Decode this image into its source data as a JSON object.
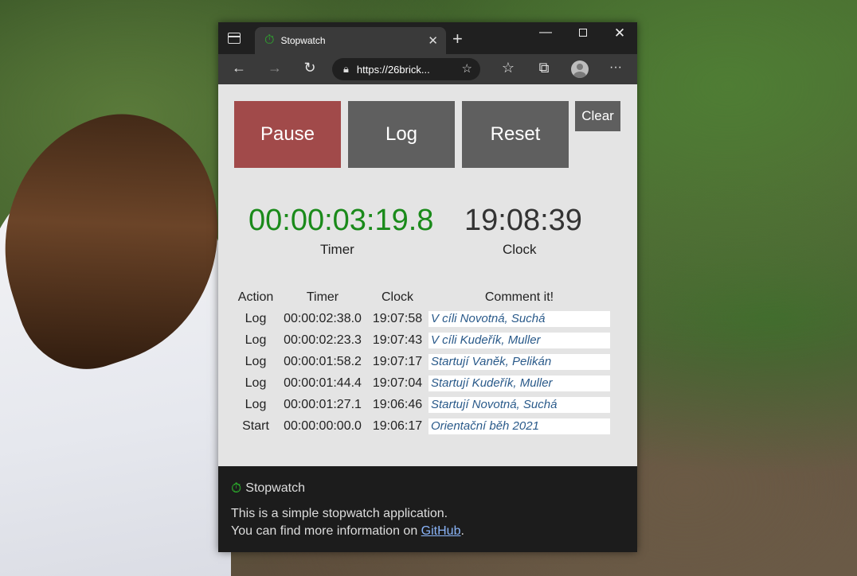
{
  "browser": {
    "tab_title": "Stopwatch",
    "url": "https://26brick...",
    "icons": {
      "tab_actions": "tab-actions-icon",
      "close": "close-icon",
      "new_tab": "plus-icon",
      "back": "arrow-left-icon",
      "forward": "arrow-right-icon",
      "reload": "reload-icon",
      "lock": "lock-icon",
      "add_favorite": "star-plus-icon",
      "favorites": "favorites-icon",
      "collections": "collections-icon",
      "more": "more-icon"
    }
  },
  "controls": {
    "pause": "Pause",
    "log": "Log",
    "reset": "Reset",
    "clear": "Clear"
  },
  "display": {
    "timer_value": "00:00:03:19.8",
    "timer_label": "Timer",
    "clock_value": "19:08:39",
    "clock_label": "Clock"
  },
  "table": {
    "headers": [
      "Action",
      "Timer",
      "Clock",
      "Comment it!"
    ],
    "rows": [
      {
        "action": "Log",
        "timer": "00:00:02:38.0",
        "clock": "19:07:58",
        "comment": "V cíli Novotná, Suchá"
      },
      {
        "action": "Log",
        "timer": "00:00:02:23.3",
        "clock": "19:07:43",
        "comment": "V cíli Kudeřík, Muller"
      },
      {
        "action": "Log",
        "timer": "00:00:01:58.2",
        "clock": "19:07:17",
        "comment": "Startují Vaněk, Pelikán"
      },
      {
        "action": "Log",
        "timer": "00:00:01:44.4",
        "clock": "19:07:04",
        "comment": "Startují Kudeřík, Muller"
      },
      {
        "action": "Log",
        "timer": "00:00:01:27.1",
        "clock": "19:06:46",
        "comment": "Startují Novotná, Suchá"
      },
      {
        "action": "Start",
        "timer": "00:00:00:00.0",
        "clock": "19:06:17",
        "comment": "Orientační běh 2021"
      }
    ]
  },
  "footer": {
    "title": "Stopwatch",
    "line1": "This is a simple stopwatch application.",
    "line2_prefix": "You can find more information on ",
    "link": "GitHub",
    "line2_suffix": "."
  },
  "colors": {
    "pause_button": "#a14a4a",
    "neutral_button": "#5f5f5f",
    "timer_text": "#1a8a1a",
    "comment_text": "#2a5a8a",
    "link": "#8ab4f8"
  }
}
